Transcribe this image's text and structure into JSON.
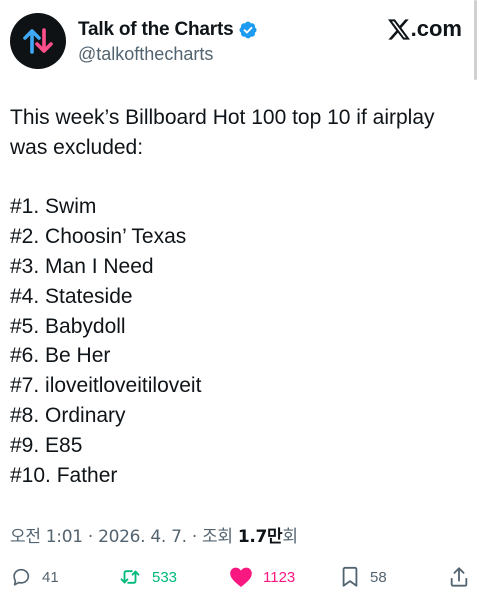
{
  "author": {
    "name": "Talk of the Charts",
    "handle": "@talkofthecharts",
    "verified": true,
    "avatar_icon": "up-down-arrows-icon"
  },
  "brand": {
    "suffix": ".com",
    "icon": "x-logo-icon"
  },
  "tweet": {
    "intro": "This week’s Billboard Hot 100 top 10 if airplay was excluded:",
    "list": [
      "#1. Swim",
      "#2. Choosin’ Texas",
      "#3. Man I Need",
      "#4. Stateside",
      "#5. Babydoll",
      "#6. Be Her",
      "#7. iloveitloveitiloveit",
      "#8. Ordinary",
      "#9. E85",
      "#10. Father"
    ]
  },
  "meta": {
    "time": "오전 1:01",
    "date": "2026. 4. 7.",
    "views_label": "조회",
    "views_value": "1.7만",
    "views_unit": "회",
    "separator": "·"
  },
  "actions": {
    "replies": "41",
    "reposts": "533",
    "likes": "1123",
    "bookmarks": "58"
  },
  "colors": {
    "text": "#0f1419",
    "muted": "#536471",
    "verified": "#1d9bf0",
    "repost": "#00ba7c",
    "like": "#f91880",
    "avatar_up": "#3fa9f5",
    "avatar_down": "#ff4f8b"
  }
}
